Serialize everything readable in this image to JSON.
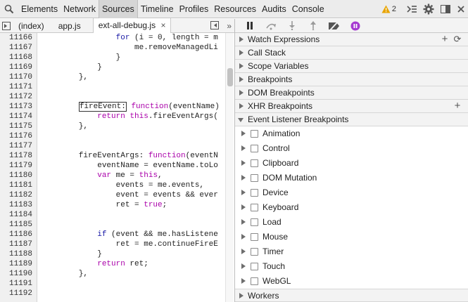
{
  "toolbar": {
    "tabs": [
      "Elements",
      "Network",
      "Sources",
      "Timeline",
      "Profiles",
      "Resources",
      "Audits",
      "Console"
    ],
    "active_tab": "Sources",
    "warning_count": "2"
  },
  "file_tabs": {
    "items": [
      "(index)",
      "app.js",
      "ext-all-debug.js"
    ],
    "active": "ext-all-debug.js"
  },
  "code": {
    "lines": [
      {
        "n": "11166",
        "t": "                for (i = 0, length = m"
      },
      {
        "n": "11167",
        "t": "                    me.removeManagedLi"
      },
      {
        "n": "11168",
        "t": "                }"
      },
      {
        "n": "11169",
        "t": "            }"
      },
      {
        "n": "11170",
        "t": "        },"
      },
      {
        "n": "11171",
        "t": ""
      },
      {
        "n": "11172",
        "t": ""
      },
      {
        "n": "11173",
        "t": "        fireEvent: function(eventName)"
      },
      {
        "n": "11174",
        "t": "            return this.fireEventArgs("
      },
      {
        "n": "11175",
        "t": "        },"
      },
      {
        "n": "11176",
        "t": ""
      },
      {
        "n": "11177",
        "t": ""
      },
      {
        "n": "11178",
        "t": "        fireEventArgs: function(eventN"
      },
      {
        "n": "11179",
        "t": "            eventName = eventName.toLo"
      },
      {
        "n": "11180",
        "t": "            var me = this,"
      },
      {
        "n": "11181",
        "t": "                events = me.events,"
      },
      {
        "n": "11182",
        "t": "                event = events && ever"
      },
      {
        "n": "11183",
        "t": "                ret = true;"
      },
      {
        "n": "11184",
        "t": ""
      },
      {
        "n": "11185",
        "t": ""
      },
      {
        "n": "11186",
        "t": "            if (event && me.hasListene"
      },
      {
        "n": "11187",
        "t": "                ret = me.continueFireE"
      },
      {
        "n": "11188",
        "t": "            }"
      },
      {
        "n": "11189",
        "t": "            return ret;"
      },
      {
        "n": "11190",
        "t": "        },"
      },
      {
        "n": "11191",
        "t": ""
      },
      {
        "n": "11192",
        "t": ""
      }
    ]
  },
  "debugger": {
    "sections": {
      "watch": "Watch Expressions",
      "callstack": "Call Stack",
      "scope": "Scope Variables",
      "breakpoints": "Breakpoints",
      "dom": "DOM Breakpoints",
      "xhr": "XHR Breakpoints",
      "event_listener": "Event Listener Breakpoints",
      "workers": "Workers"
    },
    "event_categories": [
      "Animation",
      "Control",
      "Clipboard",
      "DOM Mutation",
      "Device",
      "Keyboard",
      "Load",
      "Mouse",
      "Timer",
      "Touch",
      "WebGL"
    ]
  },
  "icons": {
    "accent_purple": "#a63ad1",
    "warning": "#e8a400"
  }
}
